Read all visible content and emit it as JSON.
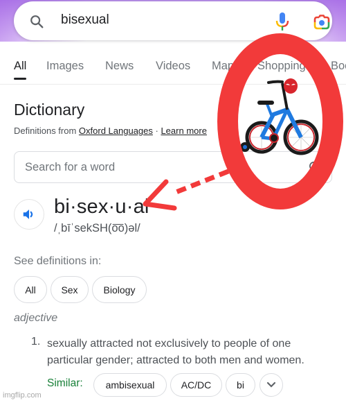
{
  "search": {
    "query": "bisexual",
    "icons": [
      "search-icon",
      "microphone-icon",
      "google-lens-icon"
    ]
  },
  "tabs": [
    {
      "label": "All",
      "active": true
    },
    {
      "label": "Images",
      "active": false
    },
    {
      "label": "News",
      "active": false
    },
    {
      "label": "Videos",
      "active": false
    },
    {
      "label": "Maps",
      "active": false
    },
    {
      "label": "Shopping",
      "active": false
    },
    {
      "label": "Books",
      "active": false
    }
  ],
  "dictionary": {
    "title": "Dictionary",
    "source_prefix": "Definitions from ",
    "source_link": "Oxford Languages",
    "separator": " · ",
    "learn_more": "Learn more",
    "word_search_placeholder": "Search for a word",
    "headword": "bi·sex·u·al",
    "phonetic": "/ˌbīˈsekSH(o͞o)əl/",
    "see_definitions_label": "See definitions in:",
    "definition_chips": [
      "All",
      "Sex",
      "Biology"
    ],
    "part_of_speech": "adjective",
    "definitions": [
      {
        "number": "1.",
        "text": "sexually attracted not exclusively to people of one particular gender; attracted to both men and women.",
        "similar_label": "Similar:",
        "similar": [
          "ambisexual",
          "AC/DC",
          "bi"
        ]
      }
    ]
  },
  "overlay": {
    "annotation": "red circle highlighting a Spider-Man kids bicycle image with dashed arrow pointing to headword",
    "color": "#f23a3a",
    "image_subject": "blue Spider-Man children's bicycle with training wheels"
  },
  "watermark": "imgflip.com"
}
